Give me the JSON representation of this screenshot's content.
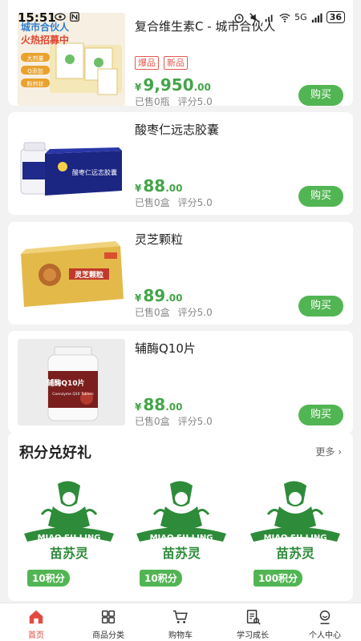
{
  "status_bar": {
    "time": "15:51",
    "network": "5G",
    "battery": "36"
  },
  "products": [
    {
      "title": "复合维生素C - 城市合伙人",
      "tags": [
        "爆品",
        "新品"
      ],
      "price_symbol": "¥",
      "price_int": "9,950",
      "price_dec": ".00",
      "sold": "已售0瓶",
      "rating": "评分5.0",
      "buy_label": "购买",
      "image_text": {
        "line1": "城市合伙人",
        "line2": "火热招募中",
        "bullets": [
          "大剂量",
          "Q添加",
          "粉剂状"
        ]
      }
    },
    {
      "title": "酸枣仁远志胶囊",
      "price_symbol": "¥",
      "price_int": "88",
      "price_dec": ".00",
      "sold": "已售0盒",
      "rating": "评分5.0",
      "buy_label": "购买",
      "image_text": {
        "box": "酸枣仁远志胶囊"
      }
    },
    {
      "title": "灵芝颗粒",
      "price_symbol": "¥",
      "price_int": "89",
      "price_dec": ".00",
      "sold": "已售0盒",
      "rating": "评分5.0",
      "buy_label": "购买",
      "image_text": {
        "box": "灵芝颗粒"
      }
    },
    {
      "title": "辅酶Q10片",
      "price_symbol": "¥",
      "price_int": "88",
      "price_dec": ".00",
      "sold": "已售0盒",
      "rating": "评分5.0",
      "buy_label": "购买",
      "image_text": {
        "label": "辅酶Q10片",
        "sub": "Coenzyme Q10 Tablets"
      }
    }
  ],
  "points_section": {
    "title": "积分兑好礼",
    "more": "更多",
    "rewards": [
      {
        "points": "10积分",
        "logo_en": "MIAO SU LING",
        "logo_cn": "苗苏灵"
      },
      {
        "points": "10积分",
        "logo_en": "MIAO SU LING",
        "logo_cn": "苗苏灵"
      },
      {
        "points": "100积分",
        "logo_en": "MIAO SU LING",
        "logo_cn": "苗苏灵"
      }
    ]
  },
  "tabbar": [
    {
      "label": "首页",
      "icon": "home-icon",
      "active": true
    },
    {
      "label": "商品分类",
      "icon": "grid-icon",
      "active": false
    },
    {
      "label": "购物车",
      "icon": "cart-icon",
      "active": false
    },
    {
      "label": "学习成长",
      "icon": "study-icon",
      "active": false
    },
    {
      "label": "个人中心",
      "icon": "profile-icon",
      "active": false
    }
  ],
  "colors": {
    "accent": "#52b553",
    "price": "#43a548",
    "tag": "#e05a4f",
    "tab_active": "#e4493e"
  }
}
